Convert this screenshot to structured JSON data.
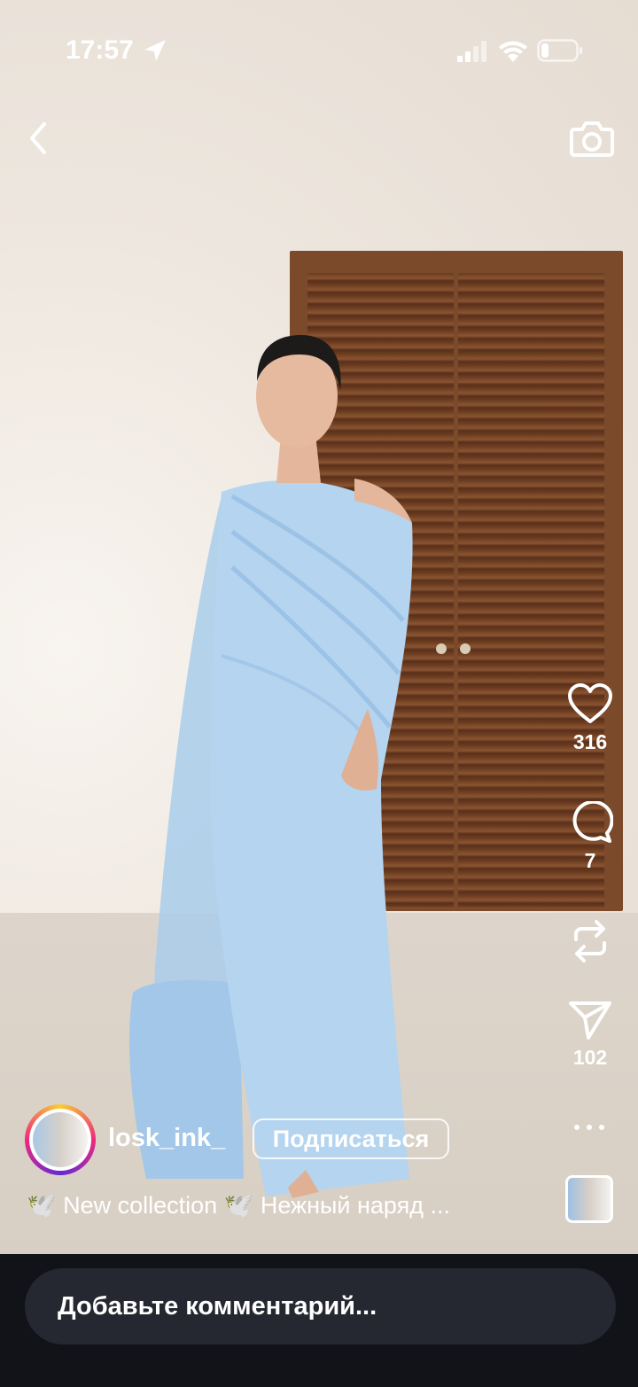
{
  "status_bar": {
    "time": "17:57"
  },
  "post": {
    "username": "losk_ink_",
    "follow_label": "Подписаться",
    "caption": "🕊️ New collection 🕊️ Нежный наряд ...",
    "likes": "316",
    "comments": "7",
    "shares": "102"
  },
  "comment_input": {
    "placeholder": "Добавьте комментарий..."
  },
  "colors": {
    "dress": "#b4d4ef",
    "door": "#7a4a2b",
    "bottom_bar": "#111318"
  }
}
